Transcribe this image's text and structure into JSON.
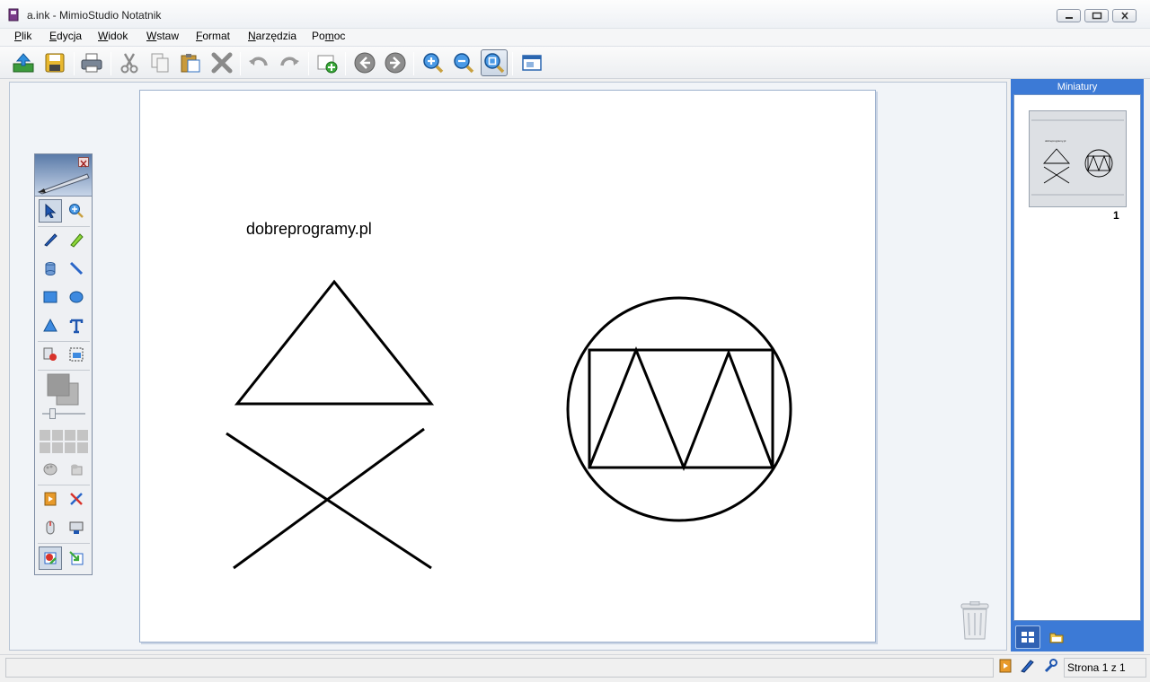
{
  "window": {
    "title": "a.ink - MimioStudio Notatnik"
  },
  "menu": {
    "items": [
      {
        "label": "Plik",
        "accel": "P",
        "rest": "lik"
      },
      {
        "label": "Edycja",
        "accel": "E",
        "rest": "dycja"
      },
      {
        "label": "Widok",
        "accel": "W",
        "rest": "idok"
      },
      {
        "label": "Wstaw",
        "accel": "W",
        "rest": "staw"
      },
      {
        "label": "Format",
        "accel": "F",
        "rest": "ormat"
      },
      {
        "label": "Narzędzia",
        "accel": "N",
        "rest": "arzędzia"
      },
      {
        "label": "Pomoc",
        "pre": "Po",
        "accel": "m",
        "rest": "oc"
      }
    ]
  },
  "toolbar": {
    "icons": [
      "open-icon",
      "save-icon",
      "print-icon",
      "cut-icon",
      "copy-icon",
      "paste-icon",
      "delete-icon",
      "undo-icon",
      "redo-icon",
      "new-page-icon",
      "back-icon",
      "forward-icon",
      "zoom-in-icon",
      "zoom-out-icon",
      "zoom-fit-icon",
      "view-icon"
    ]
  },
  "page": {
    "text": "dobreprogramy.pl"
  },
  "panel": {
    "title": "Miniatury",
    "thumbnail_number": "1",
    "thumbnail_text": "dobreprogramy.pl"
  },
  "status": {
    "page_indicator": "Strona 1 z 1"
  },
  "colors": {
    "panel_blue": "#3c7ad6",
    "page_bg": "#ffffff",
    "workspace_bg": "#f1f4f8"
  }
}
